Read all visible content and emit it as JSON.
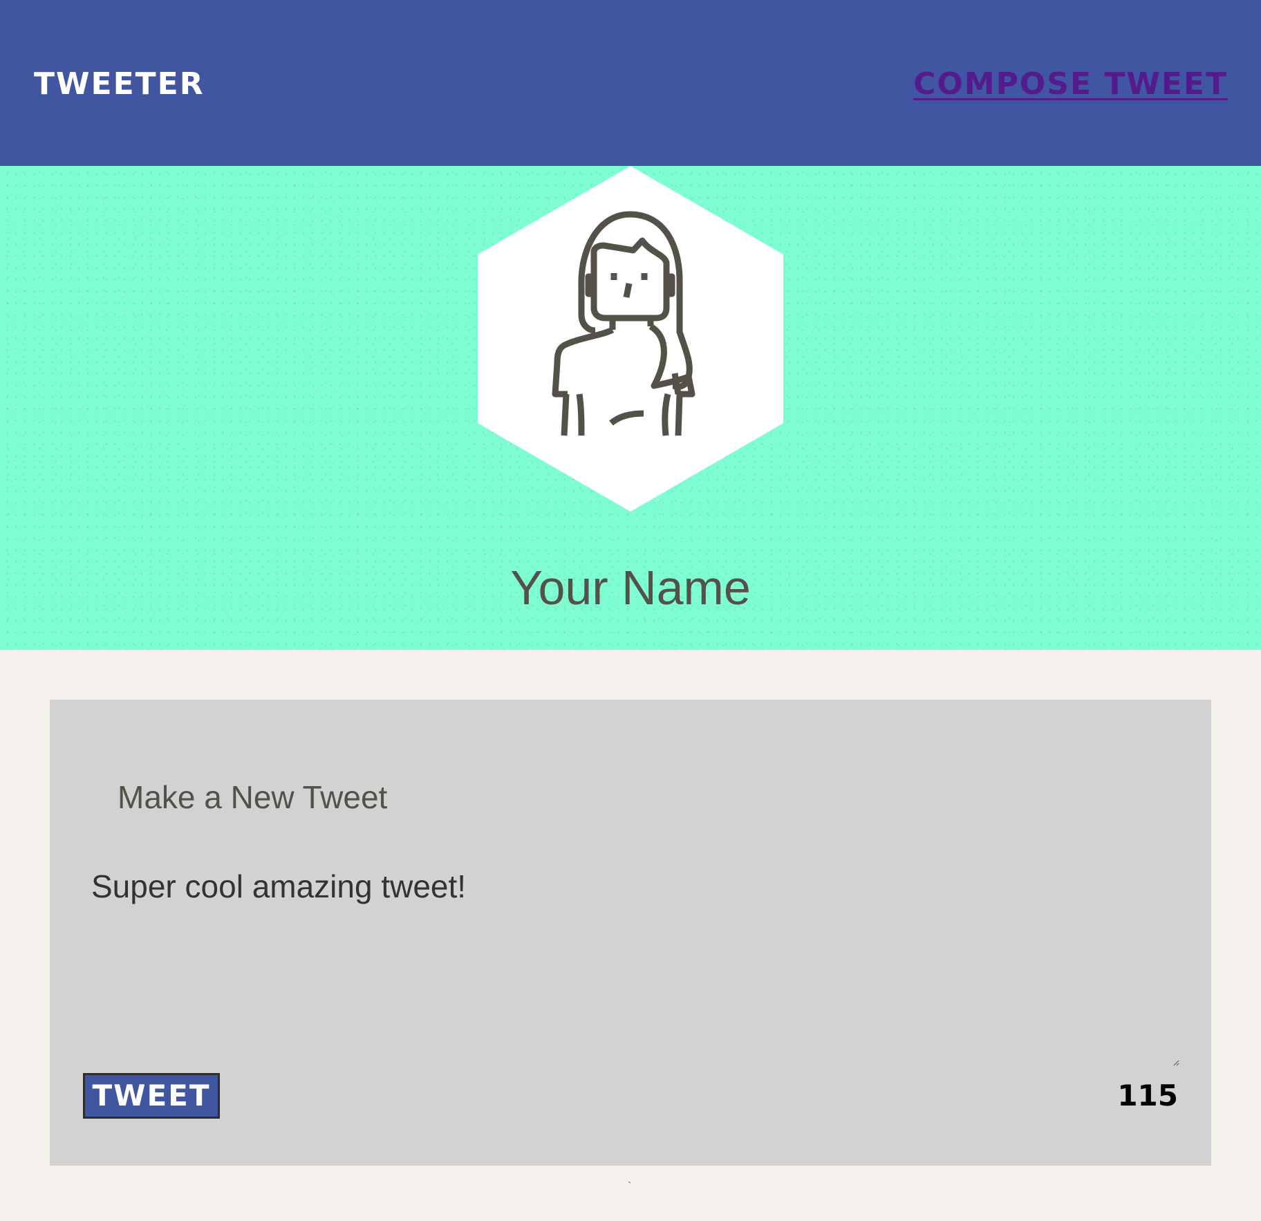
{
  "nav": {
    "brand": "TWEETER",
    "compose_link": "COMPOSE TWEET"
  },
  "profile": {
    "name": "Your Name",
    "avatar_icon": "woman-avatar-icon"
  },
  "new_tweet": {
    "title": "Make a New Tweet",
    "text": "Super cool amazing tweet!",
    "submit_label": "TWEET",
    "char_counter": "115"
  },
  "colors": {
    "nav_bg": "#4056a1",
    "link": "#551a8b",
    "header_bg": "#7ffdd2",
    "page_bg": "#f4f1ed",
    "card_bg": "#d2d2d2",
    "text": "#545149"
  }
}
